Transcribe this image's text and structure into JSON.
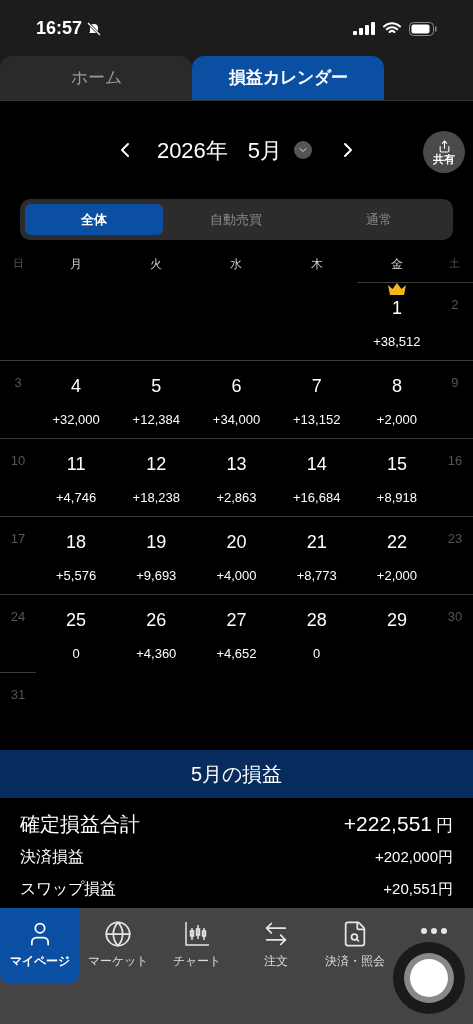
{
  "status_bar": {
    "time": "16:57"
  },
  "tabs": [
    {
      "label": "ホーム",
      "selected": false
    },
    {
      "label": "損益カレンダー",
      "selected": true
    }
  ],
  "month_nav": {
    "year": "2026年",
    "month": "5月",
    "share": "共有"
  },
  "filters": [
    {
      "label": "全体",
      "selected": true
    },
    {
      "label": "自動売買",
      "selected": false
    },
    {
      "label": "通常",
      "selected": false
    }
  ],
  "weekdays": [
    {
      "label": "日",
      "kind": "weekend"
    },
    {
      "label": "月",
      "kind": "weekday"
    },
    {
      "label": "火",
      "kind": "weekday"
    },
    {
      "label": "水",
      "kind": "weekday"
    },
    {
      "label": "木",
      "kind": "weekday"
    },
    {
      "label": "金",
      "kind": "weekday"
    },
    {
      "label": "土",
      "kind": "weekend"
    }
  ],
  "weeks": [
    {
      "days": [
        {
          "date": "1",
          "kind": "weekday",
          "pnl": "+38,512",
          "top": true
        },
        {
          "date": "2",
          "kind": "weekend"
        }
      ]
    },
    {
      "days": [
        {
          "date": "3",
          "kind": "weekend"
        },
        {
          "date": "4",
          "kind": "weekday",
          "pnl": "+32,000",
          "top": false
        },
        {
          "date": "5",
          "kind": "weekday",
          "pnl": "+12,384",
          "top": false
        },
        {
          "date": "6",
          "kind": "weekday",
          "pnl": "+34,000",
          "top": false
        },
        {
          "date": "7",
          "kind": "weekday",
          "pnl": "+13,152",
          "top": false
        },
        {
          "date": "8",
          "kind": "weekday",
          "pnl": "+2,000",
          "top": false
        },
        {
          "date": "9",
          "kind": "weekend"
        }
      ]
    },
    {
      "days": [
        {
          "date": "10",
          "kind": "weekend"
        },
        {
          "date": "11",
          "kind": "weekday",
          "pnl": "+4,746",
          "top": false
        },
        {
          "date": "12",
          "kind": "weekday",
          "pnl": "+18,238",
          "top": false
        },
        {
          "date": "13",
          "kind": "weekday",
          "pnl": "+2,863",
          "top": false
        },
        {
          "date": "14",
          "kind": "weekday",
          "pnl": "+16,684",
          "top": false
        },
        {
          "date": "15",
          "kind": "weekday",
          "pnl": "+8,918",
          "top": false
        },
        {
          "date": "16",
          "kind": "weekend"
        }
      ]
    },
    {
      "days": [
        {
          "date": "17",
          "kind": "weekend"
        },
        {
          "date": "18",
          "kind": "weekday",
          "pnl": "+5,576",
          "top": false
        },
        {
          "date": "19",
          "kind": "weekday",
          "pnl": "+9,693",
          "top": false
        },
        {
          "date": "20",
          "kind": "weekday",
          "pnl": "+4,000",
          "top": false
        },
        {
          "date": "21",
          "kind": "weekday",
          "pnl": "+8,773",
          "top": false
        },
        {
          "date": "22",
          "kind": "weekday",
          "pnl": "+2,000",
          "top": false
        },
        {
          "date": "23",
          "kind": "weekend"
        }
      ]
    },
    {
      "days": [
        {
          "date": "24",
          "kind": "weekend"
        },
        {
          "date": "25",
          "kind": "weekday",
          "pnl": "0",
          "top": false
        },
        {
          "date": "26",
          "kind": "weekday",
          "pnl": "+4,360",
          "top": false
        },
        {
          "date": "27",
          "kind": "weekday",
          "pnl": "+4,652",
          "top": false
        },
        {
          "date": "28",
          "kind": "weekday",
          "pnl": "0",
          "top": false
        },
        {
          "date": "29",
          "kind": "weekday",
          "top": false
        },
        {
          "date": "30",
          "kind": "weekend"
        }
      ]
    },
    {
      "days": [
        {
          "date": "31",
          "kind": "weekend"
        }
      ]
    }
  ],
  "summary": {
    "title": "5月の損益",
    "rows": [
      {
        "label": "確定損益合計",
        "value": "+222,551",
        "unit": "円",
        "kind": "total"
      },
      {
        "label": "決済損益",
        "value": "+202,000",
        "unit": "円",
        "kind": "item"
      },
      {
        "label": "スワップ損益",
        "value": "+20,551",
        "unit": "円",
        "kind": "item"
      }
    ]
  },
  "bottom_nav": [
    {
      "label": "マイページ",
      "selected": true
    },
    {
      "label": "マーケット",
      "selected": false
    },
    {
      "label": "チャート",
      "selected": false
    },
    {
      "label": "注文",
      "selected": false
    },
    {
      "label": "決済・照会",
      "selected": false
    },
    {
      "selected": false
    }
  ]
}
